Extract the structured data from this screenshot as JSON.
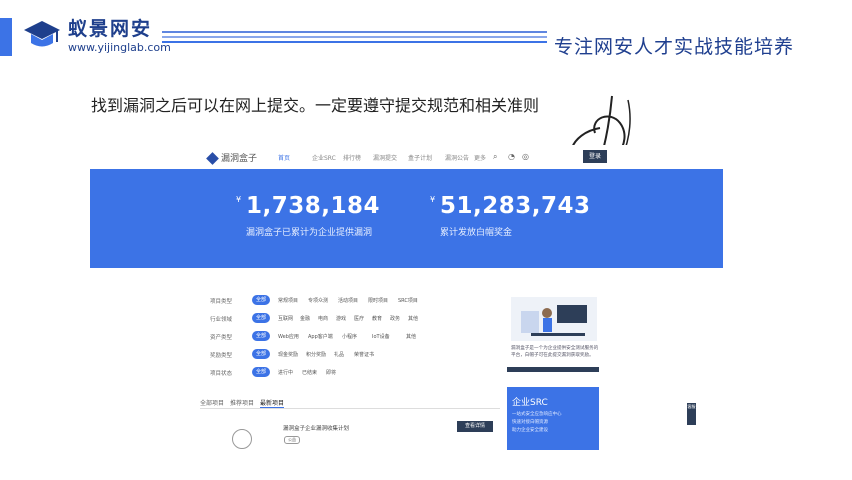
{
  "brand": {
    "name": "蚁景网安",
    "url": "www.yijinglab.com"
  },
  "slogan": "专注网安人才实战技能培养",
  "subtitle": "找到漏洞之后可以在网上提交。一定要遵守提交规范和相关准则",
  "screenshot": {
    "site_name": "漏洞盒子",
    "nav": [
      "首页",
      "企业SRC",
      "排行榜",
      "漏洞提交",
      "盒子计划",
      "漏洞公告",
      "更多"
    ],
    "nav_button": "登录",
    "stats": [
      {
        "currency": "¥",
        "value": "1,738,184",
        "label": "漏洞盒子已累计为企业提供漏洞"
      },
      {
        "currency": "¥",
        "value": "51,283,743",
        "label": "累计发放白帽奖金"
      }
    ],
    "filters": [
      {
        "label": "项目类型",
        "chip": "全部",
        "options": [
          "常规项目",
          "专项众测",
          "活动项目",
          "限时项目",
          "SRC项目"
        ]
      },
      {
        "label": "行业领域",
        "chip": "全部",
        "options": [
          "互联网",
          "金融",
          "电商",
          "游戏",
          "医疗",
          "教育",
          "政务",
          "其他"
        ]
      },
      {
        "label": "资产类型",
        "chip": "全部",
        "options": [
          "Web应用",
          "App客户端",
          "小程序",
          "IoT设备",
          "其他"
        ]
      },
      {
        "label": "奖励类型",
        "chip": "全部",
        "options": [
          "现金奖励",
          "积分奖励",
          "礼品",
          "荣誉证书"
        ]
      },
      {
        "label": "项目状态",
        "chip": "全部",
        "options": [
          "进行中",
          "已结束",
          "即将"
        ]
      }
    ],
    "side_card": {
      "text": "漏洞盒子是一个为企业提供安全测试服务的平台，白帽子可在此提交漏洞获取奖励。"
    },
    "src_card": {
      "title": "企业SRC",
      "lines": [
        "一站式安全应急响应中心",
        "快速对接白帽资源",
        "助力企业安全建设"
      ]
    },
    "tabs": [
      "全部项目",
      "推荐项目",
      "最新项目"
    ],
    "list_row": {
      "title": "漏洞盒子企业漏洞收集计划",
      "tag": "公益",
      "button": "查看详情"
    },
    "float_button": "客服"
  }
}
